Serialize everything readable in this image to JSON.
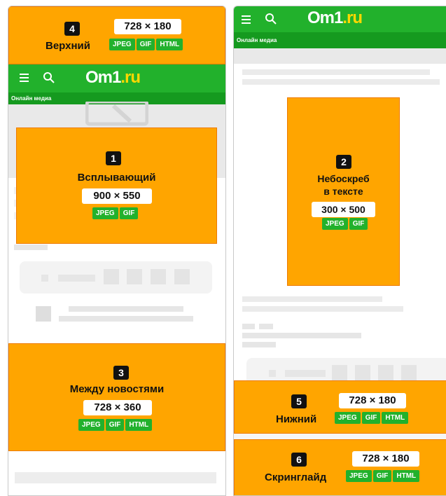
{
  "site": {
    "logo_main": "Om1",
    "logo_tld": ".ru",
    "tagline": "Онлайн медиа",
    "menu_icon": "hamburger-icon",
    "search_icon": "search-icon"
  },
  "ads": {
    "top": {
      "number": "4",
      "name": "Верхний",
      "size": "728 × 180",
      "formats": [
        "JPEG",
        "GIF",
        "HTML"
      ]
    },
    "popup": {
      "number": "1",
      "name": "Всплывающий",
      "size": "900 × 550",
      "formats": [
        "JPEG",
        "GIF"
      ]
    },
    "between": {
      "number": "3",
      "name": "Между новостями",
      "size": "728 × 360",
      "formats": [
        "JPEG",
        "GIF",
        "HTML"
      ]
    },
    "sky": {
      "number": "2",
      "name_line1": "Небоскреб",
      "name_line2": "в тексте",
      "size": "300 × 500",
      "formats": [
        "JPEG",
        "GIF"
      ]
    },
    "bottom": {
      "number": "5",
      "name": "Нижний",
      "size": "728 × 180",
      "formats": [
        "JPEG",
        "GIF",
        "HTML"
      ]
    },
    "scroll": {
      "number": "6",
      "name": "Скринглайд",
      "size": "728 × 180",
      "formats": [
        "JPEG",
        "GIF",
        "HTML"
      ]
    }
  },
  "colors": {
    "ad_fill": "#ffa500",
    "brand_green": "#22b12c",
    "format_badge": "#22b12c",
    "logo_tld": "#ffd800"
  }
}
